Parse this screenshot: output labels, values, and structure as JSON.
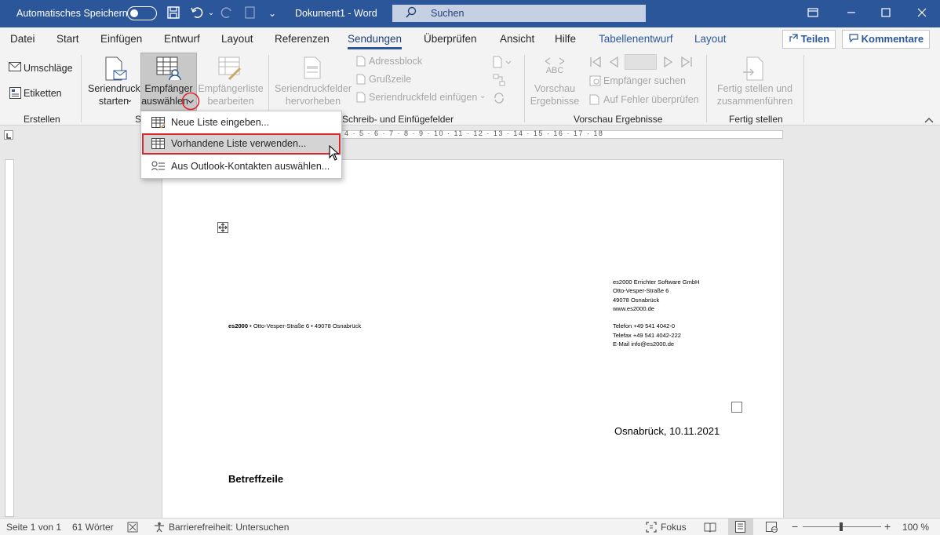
{
  "titlebar": {
    "autosave_label": "Automatisches Speichern",
    "doc_title": "Dokument1  -  Word",
    "search_placeholder": "Suchen",
    "more_icon": "⌄"
  },
  "tabs": [
    "Datei",
    "Start",
    "Einfügen",
    "Entwurf",
    "Layout",
    "Referenzen",
    "Sendungen",
    "Überprüfen",
    "Ansicht",
    "Hilfe",
    "Tabellenentwurf",
    "Layout"
  ],
  "active_tab": "Sendungen",
  "share_label": "Teilen",
  "comments_label": "Kommentare",
  "ribbon": {
    "erstellen": {
      "umschlaege": "Umschläge",
      "etiketten": "Etiketten",
      "label": "Erstellen"
    },
    "seriendruck_starten": {
      "line1": "Seriendruck",
      "line2": "starten"
    },
    "empfaenger_auswaehlen": {
      "line1": "Empfänger",
      "line2": "auswählen"
    },
    "empfaengerliste_bearbeiten": {
      "line1": "Empfängerliste",
      "line2": "bearbeiten"
    },
    "group_label_start_partial": "S",
    "seriendruckfelder": {
      "line1": "Seriendruckfelder",
      "line2": "hervorheben"
    },
    "adressblock": "Adressblock",
    "grusszeile": "Grußzeile",
    "seriendruckfeld_einfuegen": "Seriendruckfeld einfügen",
    "group_label_schreib": "Schreib- und Einfügefelder",
    "vorschau": {
      "abc": "ABC",
      "line1": "Vorschau",
      "line2": "Ergebnisse"
    },
    "empfaenger_suchen": "Empfänger suchen",
    "auf_fehler": "Auf Fehler überprüfen",
    "group_label_vorschau": "Vorschau Ergebnisse",
    "fertig": {
      "line1": "Fertig stellen und",
      "line2": "zusammenführen"
    },
    "group_label_fertig": "Fertig stellen"
  },
  "menu": {
    "items": [
      "Neue Liste eingeben...",
      "Vorhandene Liste verwenden...",
      "Aus Outlook-Kontakten auswählen..."
    ],
    "highlighted_index": 1
  },
  "ruler": {
    "numbers": "4 · 5 · 6 · 7 · 8 · 9 · 10 · 11 · 12 · 13 · 14 · 15 · 16 · 17 · 18"
  },
  "document": {
    "sender_line_bold": "es2000",
    "sender_line_rest": " • Otto-Vesper-Straße 6 • 49078 Osnabrück",
    "company": [
      "es2000 Errichter Software GmbH",
      "Otto-Vesper-Straße 6",
      "49078 Osnabrück",
      "www.es2000.de",
      "",
      "Telefon +49 541 4042-0",
      "Telefax +49 541 4042-222",
      "E-Mail info@es2000.de"
    ],
    "date_line": "Osnabrück, 10.11.2021",
    "subject": "Betreffzeile"
  },
  "statusbar": {
    "page": "Seite 1 von 1",
    "words": "61 Wörter",
    "accessibility": "Barrierefreiheit: Untersuchen",
    "focus": "Fokus",
    "zoom": "100 %",
    "zoom_minus": "−",
    "zoom_plus": "+"
  }
}
